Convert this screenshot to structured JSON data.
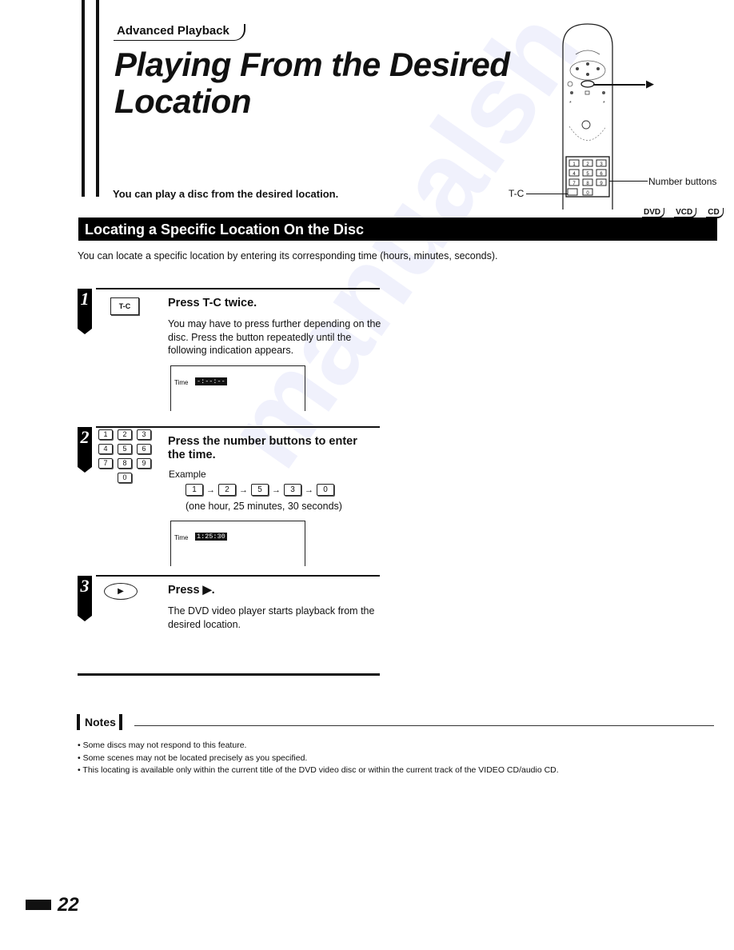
{
  "header": {
    "breadcrumb": "Advanced Playback",
    "title_line1": "Playing From the Desired",
    "title_line2": "Location",
    "intro": "You can play a disc from the desired location."
  },
  "remote": {
    "tc_label": "T-C",
    "play_label": "▶",
    "number_buttons_label": "Number buttons",
    "keys": [
      "1",
      "2",
      "3",
      "4",
      "5",
      "6",
      "7",
      "8",
      "9",
      "0"
    ]
  },
  "disc_types": [
    "DVD",
    "VCD",
    "CD"
  ],
  "section": {
    "heading": "Locating a Specific Location On the Disc",
    "description": "You can locate a specific location by entering its corresponding time (hours, minutes, seconds)."
  },
  "steps": [
    {
      "number": "1",
      "button_label": "T-C",
      "title": "Press T-C twice.",
      "body": "You may have to press further depending on the disc. Press the button repeatedly until the following indication appears.",
      "osd": {
        "label": "Time",
        "value": "-:--:--"
      }
    },
    {
      "number": "2",
      "keypad": [
        "1",
        "2",
        "3",
        "4",
        "5",
        "6",
        "7",
        "8",
        "9",
        "0"
      ],
      "title": "Press the number buttons to enter the time.",
      "example_label": "Example",
      "example_sequence": [
        "1",
        "2",
        "5",
        "3",
        "0"
      ],
      "sequence_arrow": "→",
      "example_note": "(one hour, 25 minutes, 30 seconds)",
      "osd": {
        "label": "Time",
        "value": "1:25:30"
      }
    },
    {
      "number": "3",
      "button_label": "▶",
      "title": "Press ▶.",
      "body": "The DVD video player starts playback from the desired location."
    }
  ],
  "notes": {
    "label": "Notes",
    "items": [
      "Some discs may not respond to this feature.",
      "Some scenes may not be located precisely as you specified.",
      "This locating is available only within the current title of the DVD video disc or within the current track of the VIDEO CD/audio CD."
    ]
  },
  "footer": {
    "page_number": "22"
  },
  "watermark": "manualsh"
}
